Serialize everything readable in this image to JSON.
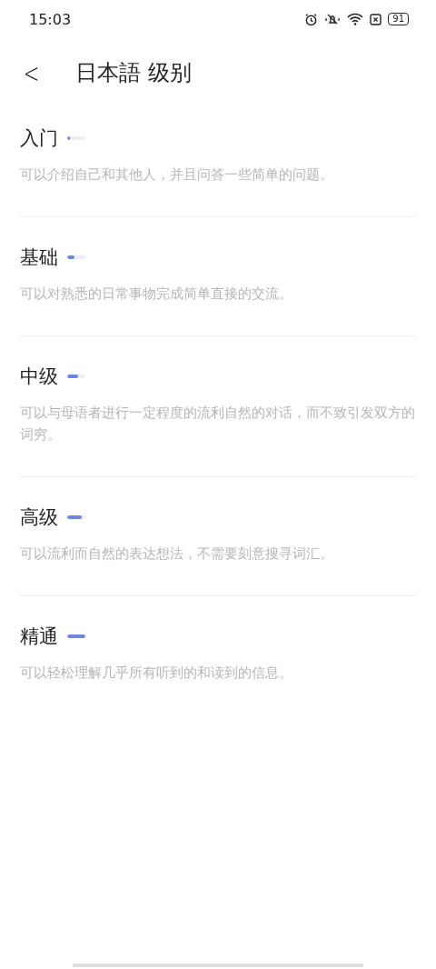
{
  "status_bar": {
    "time": "15:03",
    "battery": "91"
  },
  "header": {
    "back": "<",
    "title": "日本語 级别"
  },
  "levels": [
    {
      "name": "入门",
      "level": 0.15,
      "description": "可以介绍自己和其他人，并且问答一些简单的问题。"
    },
    {
      "name": "基础",
      "level": 0.4,
      "description": "可以对熟悉的日常事物完成简单直接的交流。"
    },
    {
      "name": "中级",
      "level": 0.6,
      "description": "可以与母语者进行一定程度的流利自然的对话，而不致引发双方的词穷。"
    },
    {
      "name": "高级",
      "level": 0.8,
      "description": "可以流利而自然的表达想法，不需要刻意搜寻词汇。"
    },
    {
      "name": "精通",
      "level": 1,
      "description": "可以轻松理解几乎所有听到的和读到的信息。"
    }
  ]
}
